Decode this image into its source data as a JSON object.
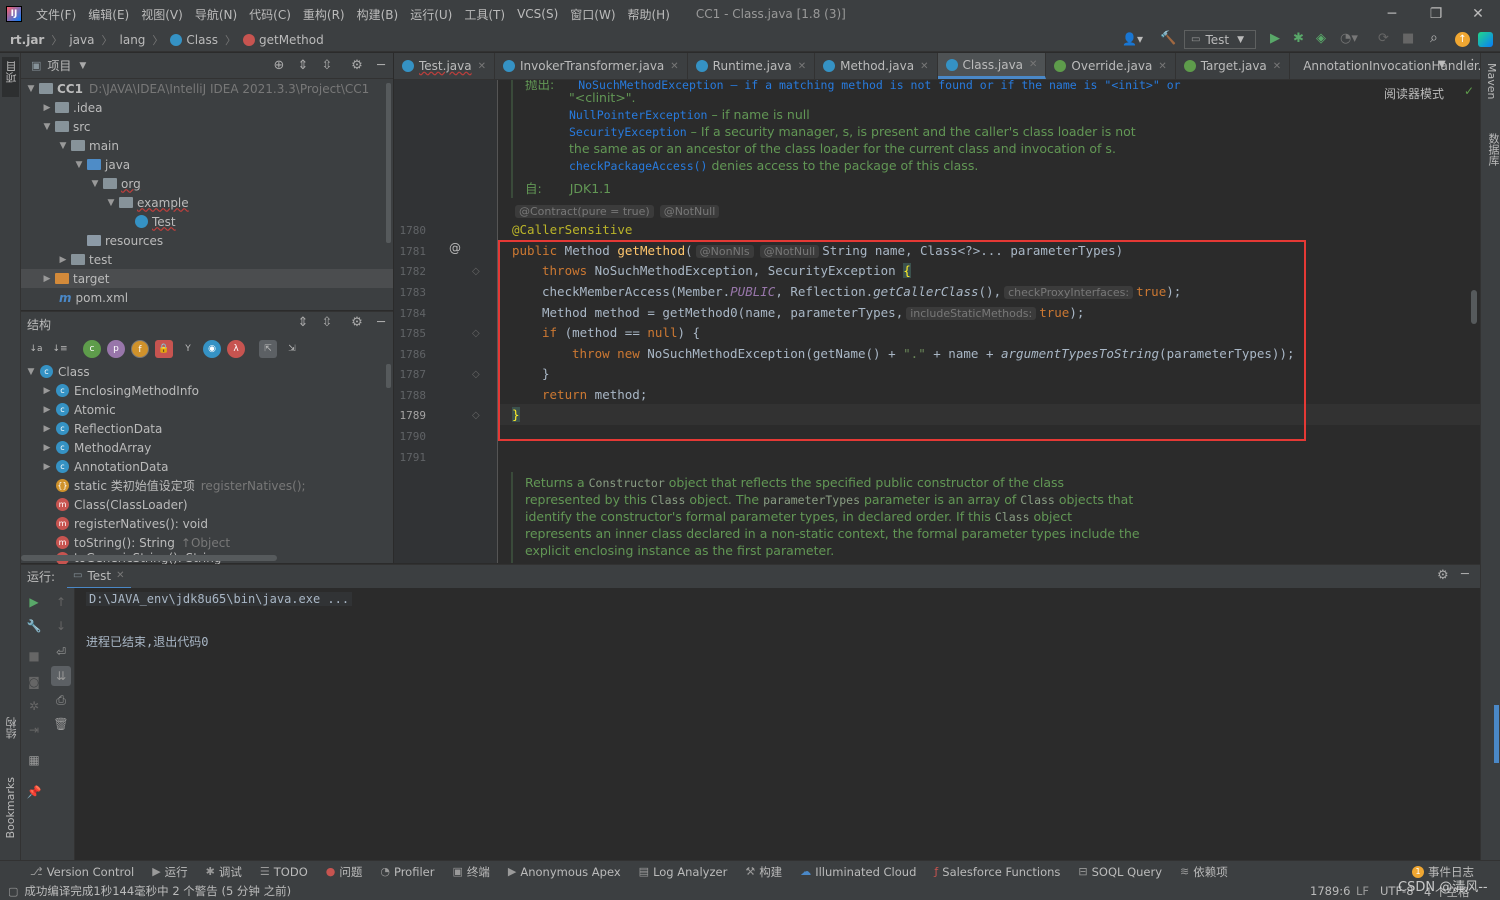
{
  "menubar": {
    "items": [
      "文件(F)",
      "编辑(E)",
      "视图(V)",
      "导航(N)",
      "代码(C)",
      "重构(R)",
      "构建(B)",
      "运行(U)",
      "工具(T)",
      "VCS(S)",
      "窗口(W)",
      "帮助(H)"
    ],
    "title": "CC1 - Class.java [1.8 (3)]"
  },
  "navbar": {
    "crumbs": [
      "rt.jar",
      "java",
      "lang",
      "Class",
      "getMethod"
    ],
    "run_config": "Test"
  },
  "left_strip": {
    "project_label": "项目",
    "structure_label": "结构",
    "bookmarks_label": "Bookmarks"
  },
  "right_strip": {
    "maven_label": "Maven",
    "database_label": "数据库"
  },
  "project": {
    "title": "项目",
    "rows": [
      {
        "label": "CC1",
        "path": "D:\\JAVA\\IDEA\\IntelliJ IDEA 2021.3.3\\Project\\CC1"
      },
      {
        "label": ".idea"
      },
      {
        "label": "src"
      },
      {
        "label": "main"
      },
      {
        "label": "java"
      },
      {
        "label": "org"
      },
      {
        "label": "example"
      },
      {
        "label": "Test"
      },
      {
        "label": "resources"
      },
      {
        "label": "test"
      },
      {
        "label": "target"
      },
      {
        "label": "pom.xml"
      }
    ]
  },
  "structure": {
    "title": "结构",
    "rows": [
      {
        "label": "Class",
        "extra": ""
      },
      {
        "label": "EnclosingMethodInfo",
        "extra": ""
      },
      {
        "label": "Atomic",
        "extra": ""
      },
      {
        "label": "ReflectionData",
        "extra": ""
      },
      {
        "label": "MethodArray",
        "extra": ""
      },
      {
        "label": "AnnotationData",
        "extra": ""
      },
      {
        "label": "static 类初始值设定项",
        "extra": "registerNatives();"
      },
      {
        "label": "Class(ClassLoader)",
        "extra": ""
      },
      {
        "label": "registerNatives(): void",
        "extra": ""
      },
      {
        "label": "toString(): String",
        "extra": "↑Object"
      },
      {
        "label": "toGenericString(): String",
        "extra": ""
      }
    ]
  },
  "tabs": [
    {
      "label": "Test.java",
      "active": false
    },
    {
      "label": "InvokerTransformer.java",
      "active": false
    },
    {
      "label": "Runtime.java",
      "active": false
    },
    {
      "label": "Method.java",
      "active": false
    },
    {
      "label": "Class.java",
      "active": true
    },
    {
      "label": "Override.java",
      "active": false
    },
    {
      "label": "Target.java",
      "active": false
    },
    {
      "label": "AnnotationInvocationHandler.class",
      "active": false
    }
  ],
  "editor": {
    "reader_mode": "阅读器模式",
    "doc_top": {
      "l0": "抛出:",
      "l0b": "NoSuchMethodException – if a matching method is not found or if the name is \"<init>\" or",
      "l1": "\"<clinit>\".",
      "l2a": "NullPointerException",
      "l2b": " – if name is null",
      "l3a": "SecurityException",
      "l3b": " – If a security manager, s, is present and the caller's class loader is not",
      "l4": "the same as or an ancestor of the class loader for the current class and invocation of s.",
      "l5a": "checkPackageAccess()",
      "l5b": " denies access to the package of this class.",
      "since_label": "自:",
      "since_value": "JDK1.1"
    },
    "contract_hint": "@Contract(pure = true)",
    "notnull_hint": "@NotNull",
    "line_numbers": [
      "1780",
      "1781",
      "1782",
      "1783",
      "1784",
      "1785",
      "1786",
      "1787",
      "1788",
      "1789",
      "1790",
      "1791"
    ],
    "code": {
      "l1780": "@CallerSensitive",
      "l1781_kw": "public",
      "l1781_type": " Method ",
      "l1781_fn": "getMethod",
      "l1781_paren": "(",
      "l1781_h1": "@NonNls",
      "l1781_h2": "@NotNull",
      "l1781_rest": "String name, Class<?>... parameterTypes)",
      "l1782_kw": "throws",
      "l1782_rest": " NoSuchMethodException, SecurityException ",
      "l1782_brace": "{",
      "l1783_a": "checkMemberAccess(Member.",
      "l1783_pub": "PUBLIC",
      "l1783_b": ", Reflection.",
      "l1783_fn": "getCallerClass",
      "l1783_c": "(),",
      "l1783_hint": "checkProxyInterfaces:",
      "l1783_true": "true",
      "l1783_end": ");",
      "l1784_a": "Method method = getMethod0(name, parameterTypes,",
      "l1784_hint": "includeStaticMethods:",
      "l1784_true": "true",
      "l1784_end": ");",
      "l1785_kw": "if",
      "l1785_a": " (method == ",
      "l1785_null": "null",
      "l1785_b": ") {",
      "l1786_kw1": "throw",
      "l1786_kw2": "new",
      "l1786_a": " NoSuchMethodException(getName() + ",
      "l1786_str": "\".\"",
      "l1786_b": " + name + ",
      "l1786_it": "argumentTypesToString",
      "l1786_c": "(parameterTypes));",
      "l1787": "}",
      "l1788_kw": "return",
      "l1788_a": " method;",
      "l1789": "}"
    },
    "doc_bottom": {
      "b1a": "Returns a ",
      "b1b": "Constructor",
      "b1c": " object that reflects the specified public constructor of the class",
      "b2a": "represented by this ",
      "b2b": "Class",
      "b2c": " object. The ",
      "b2d": "parameterTypes",
      "b2e": " parameter is an array of ",
      "b2f": "Class",
      "b2g": " objects that",
      "b3a": "identify the constructor's formal parameter types, in declared order. If this ",
      "b3b": "Class",
      "b3c": " object",
      "b4": "represents an inner class declared in a non-static context, the formal parameter types include the",
      "b5": "explicit enclosing instance as the first parameter."
    }
  },
  "run": {
    "label": "运行:",
    "tab": "Test",
    "console": [
      "D:\\JAVA_env\\jdk8u65\\bin\\java.exe ...",
      "进程已结束,退出代码0"
    ]
  },
  "bottombar": {
    "items": [
      "Version Control",
      "运行",
      "调试",
      "TODO",
      "问题",
      "Profiler",
      "终端",
      "Anonymous Apex",
      "Log Analyzer",
      "构建",
      "Illuminated Cloud",
      "Salesforce Functions",
      "SOQL Query",
      "依赖项"
    ],
    "event_log": "事件日志"
  },
  "statusbar": {
    "message": "成功编译完成1秒144毫秒中 2 个警告 (5 分钟 之前)",
    "position": "1789:6",
    "line_sep": "LF",
    "encoding": "UTF-8",
    "indent": "4 个空格",
    "watermark": "CSDN @清风--"
  },
  "colors": {
    "highlight_box": "#e53935",
    "accent": "#4a88c7"
  }
}
